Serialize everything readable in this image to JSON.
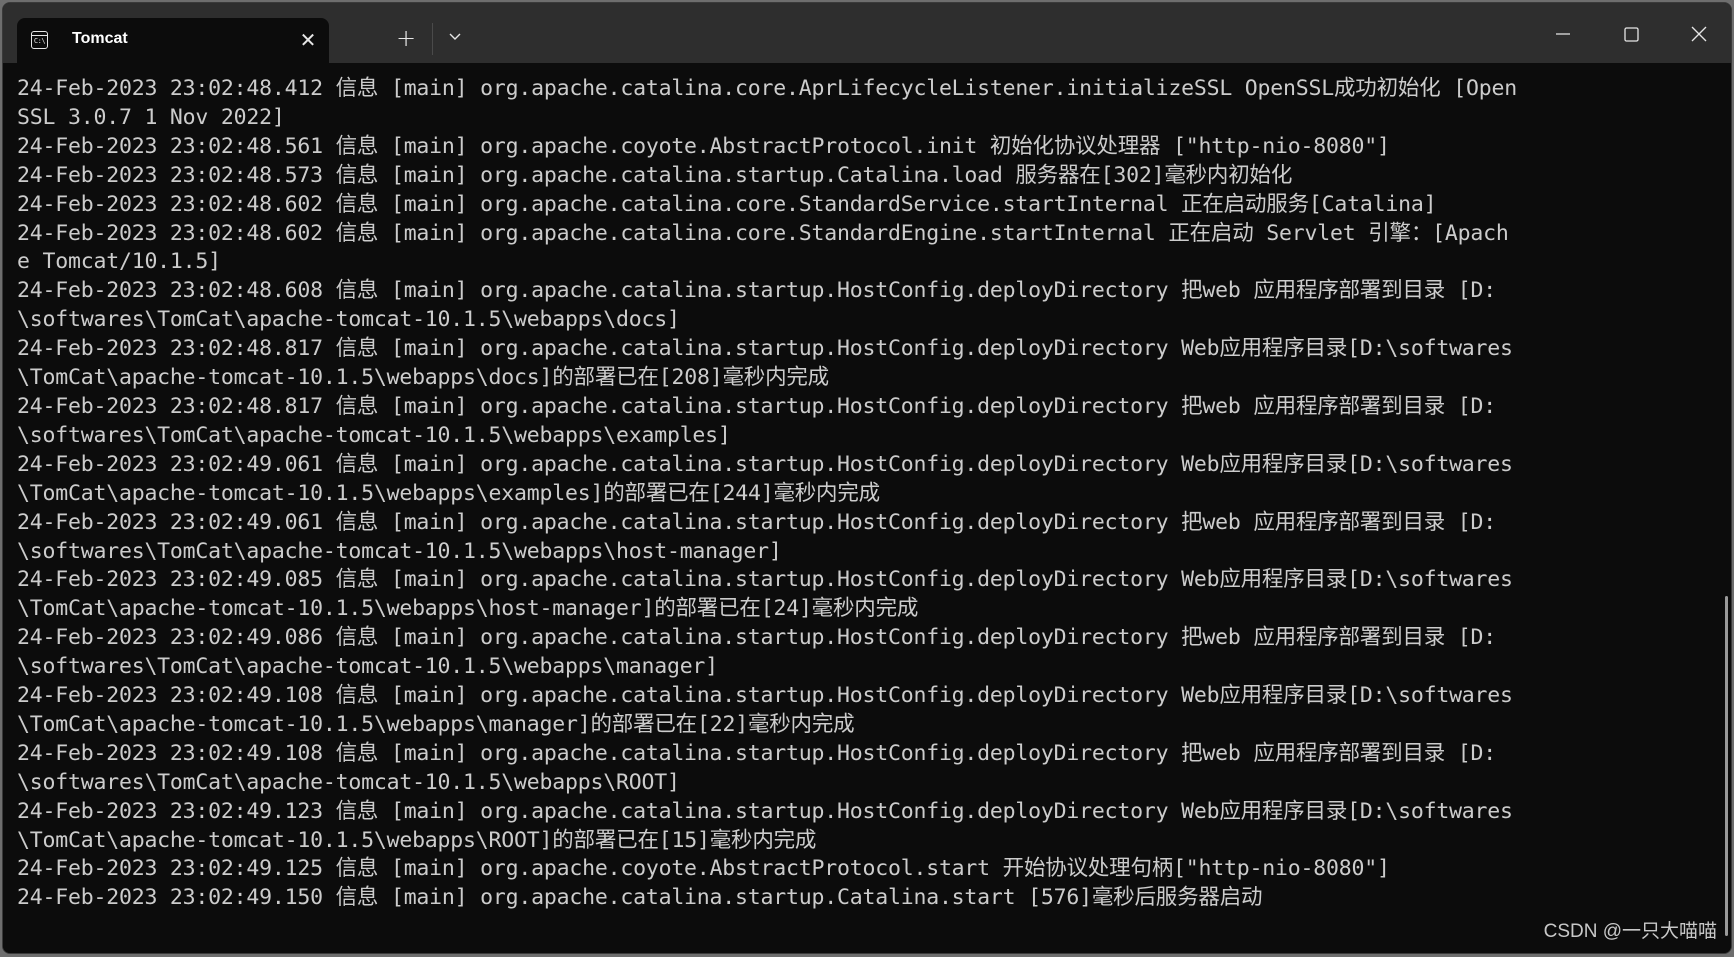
{
  "window": {
    "tab_title": "Tomcat",
    "tab_icon_text": "C:\\",
    "new_tab_label": "+",
    "close_tab_label": "✕"
  },
  "terminal": {
    "lines": [
      "24-Feb-2023 23:02:48.412 信息 [main] org.apache.catalina.core.AprLifecycleListener.initializeSSL OpenSSL成功初始化 [Open",
      "SSL 3.0.7 1 Nov 2022]",
      "24-Feb-2023 23:02:48.561 信息 [main] org.apache.coyote.AbstractProtocol.init 初始化协议处理器 [\"http-nio-8080\"]",
      "24-Feb-2023 23:02:48.573 信息 [main] org.apache.catalina.startup.Catalina.load 服务器在[302]毫秒内初始化",
      "24-Feb-2023 23:02:48.602 信息 [main] org.apache.catalina.core.StandardService.startInternal 正在启动服务[Catalina]",
      "24-Feb-2023 23:02:48.602 信息 [main] org.apache.catalina.core.StandardEngine.startInternal 正在启动 Servlet 引擎：[Apach",
      "e Tomcat/10.1.5]",
      "24-Feb-2023 23:02:48.608 信息 [main] org.apache.catalina.startup.HostConfig.deployDirectory 把web 应用程序部署到目录 [D:",
      "\\softwares\\TomCat\\apache-tomcat-10.1.5\\webapps\\docs]",
      "24-Feb-2023 23:02:48.817 信息 [main] org.apache.catalina.startup.HostConfig.deployDirectory Web应用程序目录[D:\\softwares",
      "\\TomCat\\apache-tomcat-10.1.5\\webapps\\docs]的部署已在[208]毫秒内完成",
      "24-Feb-2023 23:02:48.817 信息 [main] org.apache.catalina.startup.HostConfig.deployDirectory 把web 应用程序部署到目录 [D:",
      "\\softwares\\TomCat\\apache-tomcat-10.1.5\\webapps\\examples]",
      "24-Feb-2023 23:02:49.061 信息 [main] org.apache.catalina.startup.HostConfig.deployDirectory Web应用程序目录[D:\\softwares",
      "\\TomCat\\apache-tomcat-10.1.5\\webapps\\examples]的部署已在[244]毫秒内完成",
      "24-Feb-2023 23:02:49.061 信息 [main] org.apache.catalina.startup.HostConfig.deployDirectory 把web 应用程序部署到目录 [D:",
      "\\softwares\\TomCat\\apache-tomcat-10.1.5\\webapps\\host-manager]",
      "24-Feb-2023 23:02:49.085 信息 [main] org.apache.catalina.startup.HostConfig.deployDirectory Web应用程序目录[D:\\softwares",
      "\\TomCat\\apache-tomcat-10.1.5\\webapps\\host-manager]的部署已在[24]毫秒内完成",
      "24-Feb-2023 23:02:49.086 信息 [main] org.apache.catalina.startup.HostConfig.deployDirectory 把web 应用程序部署到目录 [D:",
      "\\softwares\\TomCat\\apache-tomcat-10.1.5\\webapps\\manager]",
      "24-Feb-2023 23:02:49.108 信息 [main] org.apache.catalina.startup.HostConfig.deployDirectory Web应用程序目录[D:\\softwares",
      "\\TomCat\\apache-tomcat-10.1.5\\webapps\\manager]的部署已在[22]毫秒内完成",
      "24-Feb-2023 23:02:49.108 信息 [main] org.apache.catalina.startup.HostConfig.deployDirectory 把web 应用程序部署到目录 [D:",
      "\\softwares\\TomCat\\apache-tomcat-10.1.5\\webapps\\ROOT]",
      "24-Feb-2023 23:02:49.123 信息 [main] org.apache.catalina.startup.HostConfig.deployDirectory Web应用程序目录[D:\\softwares",
      "\\TomCat\\apache-tomcat-10.1.5\\webapps\\ROOT]的部署已在[15]毫秒内完成",
      "24-Feb-2023 23:02:49.125 信息 [main] org.apache.coyote.AbstractProtocol.start 开始协议处理句柄[\"http-nio-8080\"]",
      "24-Feb-2023 23:02:49.150 信息 [main] org.apache.catalina.startup.Catalina.start [576]毫秒后服务器启动"
    ]
  },
  "watermark": "CSDN @一只大喵喵",
  "colors": {
    "terminal_bg": "#0c0c0c",
    "titlebar_bg": "#2e2e2e",
    "text": "#cccccc"
  }
}
